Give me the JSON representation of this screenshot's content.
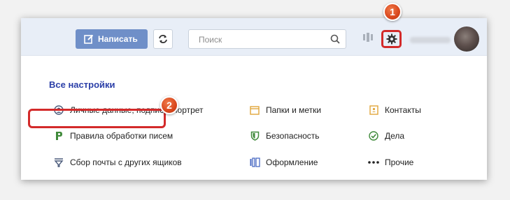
{
  "toolbar": {
    "compose_label": "Написать",
    "search_placeholder": "Поиск"
  },
  "markers": {
    "gear": "1",
    "rules": "2"
  },
  "settings": {
    "title": "Все настройки",
    "items": [
      {
        "label": "Личные данные, подпись, портрет",
        "icon": "person-icon"
      },
      {
        "label": "Папки и метки",
        "icon": "folder-icon"
      },
      {
        "label": "Контакты",
        "icon": "contacts-icon"
      },
      {
        "label": "Правила обработки писем",
        "icon": "rules-icon"
      },
      {
        "label": "Безопасность",
        "icon": "shield-icon"
      },
      {
        "label": "Дела",
        "icon": "check-icon"
      },
      {
        "label": "Сбор почты с других ящиков",
        "icon": "collector-icon"
      },
      {
        "label": "Оформление",
        "icon": "theme-icon"
      },
      {
        "label": "Прочие",
        "icon": "more-icon"
      }
    ]
  },
  "colors": {
    "accent": "#2b3fa8",
    "compose_bg": "#6f8fc8",
    "highlight": "#d32a2a",
    "badge": "#d9471d",
    "folder": "#e0a63a",
    "shield": "#3f8a3a"
  }
}
